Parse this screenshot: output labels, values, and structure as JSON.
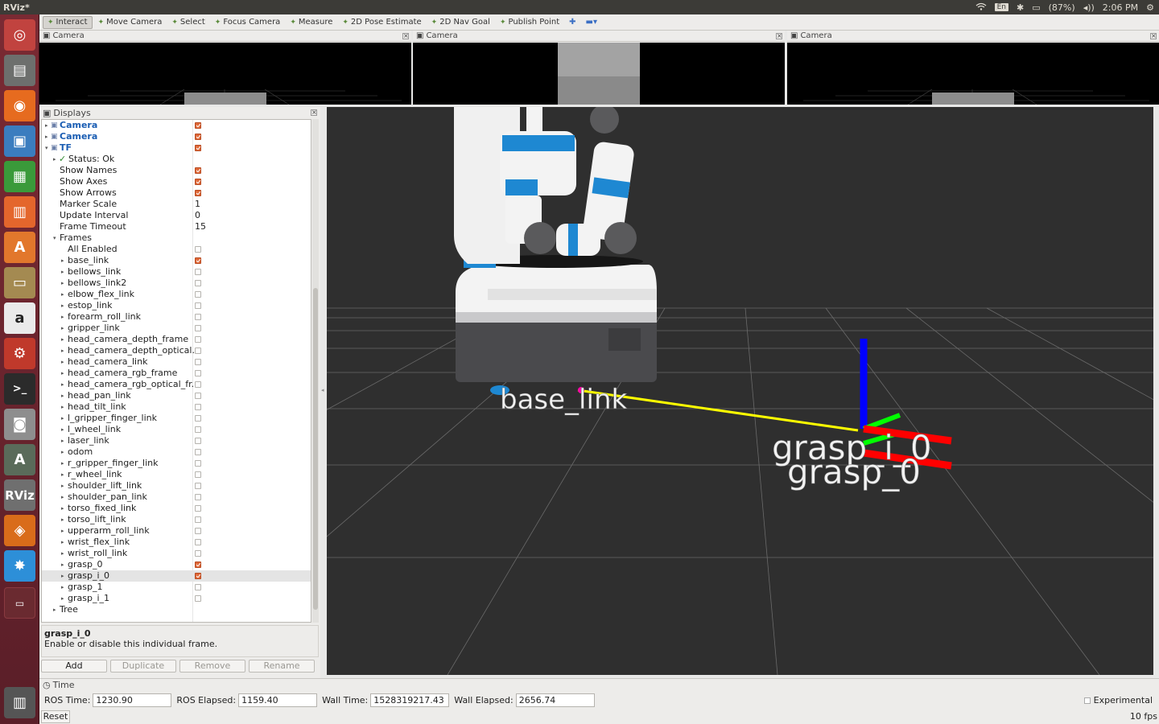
{
  "window": {
    "title": "RViz*"
  },
  "system_tray": {
    "keyboard": "En",
    "battery": "(87%)",
    "time": "2:06 PM"
  },
  "launcher": {
    "icons": [
      "ubuntu-icon",
      "files-icon",
      "firefox-icon",
      "image-viewer-icon",
      "spreadsheet-icon",
      "presentation-icon",
      "software-center-icon",
      "archive-manager-icon",
      "amazon-icon",
      "system-settings-icon",
      "terminal-icon",
      "screenshot-icon",
      "software-updater-icon",
      "rviz-icon",
      "app-icon",
      "gazebo-icon",
      "workspace-icon",
      "trash-icon"
    ],
    "rviz_label": "RViz"
  },
  "toolbar": {
    "tools": [
      {
        "label": "Interact",
        "icon": "interact-icon",
        "active": true
      },
      {
        "label": "Move Camera",
        "icon": "move-camera-icon",
        "active": false
      },
      {
        "label": "Select",
        "icon": "select-icon",
        "active": false
      },
      {
        "label": "Focus Camera",
        "icon": "focus-camera-icon",
        "active": false
      },
      {
        "label": "Measure",
        "icon": "measure-icon",
        "active": false
      },
      {
        "label": "2D Pose Estimate",
        "icon": "pose-estimate-icon",
        "active": false
      },
      {
        "label": "2D Nav Goal",
        "icon": "nav-goal-icon",
        "active": false
      },
      {
        "label": "Publish Point",
        "icon": "publish-point-icon",
        "active": false
      }
    ]
  },
  "camera_panels": [
    {
      "title": "Camera"
    },
    {
      "title": "Camera"
    },
    {
      "title": "Camera"
    }
  ],
  "displays": {
    "title": "Displays",
    "tree": [
      {
        "label": "Camera",
        "level": 0,
        "blue": true,
        "check": true,
        "arrow": "closed"
      },
      {
        "label": "Camera",
        "level": 0,
        "blue": true,
        "check": true,
        "arrow": "closed"
      },
      {
        "label": "TF",
        "level": 0,
        "blue": true,
        "check": true,
        "arrow": "open"
      },
      {
        "label": "Status: Ok",
        "level": 1,
        "status": true,
        "arrow": "closed"
      },
      {
        "label": "Show Names",
        "level": 1,
        "check": true
      },
      {
        "label": "Show Axes",
        "level": 1,
        "check": true
      },
      {
        "label": "Show Arrows",
        "level": 1,
        "check": true
      },
      {
        "label": "Marker Scale",
        "level": 1,
        "value": "1"
      },
      {
        "label": "Update Interval",
        "level": 1,
        "value": "0"
      },
      {
        "label": "Frame Timeout",
        "level": 1,
        "value": "15"
      },
      {
        "label": "Frames",
        "level": 1,
        "arrow": "open"
      },
      {
        "label": "All Enabled",
        "level": 2,
        "check": false
      },
      {
        "label": "base_link",
        "level": 2,
        "check": true,
        "arrow": "closed"
      },
      {
        "label": "bellows_link",
        "level": 2,
        "check": false,
        "arrow": "closed"
      },
      {
        "label": "bellows_link2",
        "level": 2,
        "check": false,
        "arrow": "closed"
      },
      {
        "label": "elbow_flex_link",
        "level": 2,
        "check": false,
        "arrow": "closed"
      },
      {
        "label": "estop_link",
        "level": 2,
        "check": false,
        "arrow": "closed"
      },
      {
        "label": "forearm_roll_link",
        "level": 2,
        "check": false,
        "arrow": "closed"
      },
      {
        "label": "gripper_link",
        "level": 2,
        "check": false,
        "arrow": "closed"
      },
      {
        "label": "head_camera_depth_frame",
        "level": 2,
        "check": false,
        "arrow": "closed"
      },
      {
        "label": "head_camera_depth_optical...",
        "level": 2,
        "check": false,
        "arrow": "closed"
      },
      {
        "label": "head_camera_link",
        "level": 2,
        "check": false,
        "arrow": "closed"
      },
      {
        "label": "head_camera_rgb_frame",
        "level": 2,
        "check": false,
        "arrow": "closed"
      },
      {
        "label": "head_camera_rgb_optical_fr...",
        "level": 2,
        "check": false,
        "arrow": "closed"
      },
      {
        "label": "head_pan_link",
        "level": 2,
        "check": false,
        "arrow": "closed"
      },
      {
        "label": "head_tilt_link",
        "level": 2,
        "check": false,
        "arrow": "closed"
      },
      {
        "label": "l_gripper_finger_link",
        "level": 2,
        "check": false,
        "arrow": "closed"
      },
      {
        "label": "l_wheel_link",
        "level": 2,
        "check": false,
        "arrow": "closed"
      },
      {
        "label": "laser_link",
        "level": 2,
        "check": false,
        "arrow": "closed"
      },
      {
        "label": "odom",
        "level": 2,
        "check": false,
        "arrow": "closed"
      },
      {
        "label": "r_gripper_finger_link",
        "level": 2,
        "check": false,
        "arrow": "closed"
      },
      {
        "label": "r_wheel_link",
        "level": 2,
        "check": false,
        "arrow": "closed"
      },
      {
        "label": "shoulder_lift_link",
        "level": 2,
        "check": false,
        "arrow": "closed"
      },
      {
        "label": "shoulder_pan_link",
        "level": 2,
        "check": false,
        "arrow": "closed"
      },
      {
        "label": "torso_fixed_link",
        "level": 2,
        "check": false,
        "arrow": "closed"
      },
      {
        "label": "torso_lift_link",
        "level": 2,
        "check": false,
        "arrow": "closed"
      },
      {
        "label": "upperarm_roll_link",
        "level": 2,
        "check": false,
        "arrow": "closed"
      },
      {
        "label": "wrist_flex_link",
        "level": 2,
        "check": false,
        "arrow": "closed"
      },
      {
        "label": "wrist_roll_link",
        "level": 2,
        "check": false,
        "arrow": "closed"
      },
      {
        "label": "grasp_0",
        "level": 2,
        "check": true,
        "arrow": "closed"
      },
      {
        "label": "grasp_i_0",
        "level": 2,
        "check": true,
        "arrow": "closed",
        "selected": true
      },
      {
        "label": "grasp_1",
        "level": 2,
        "check": false,
        "arrow": "closed"
      },
      {
        "label": "grasp_i_1",
        "level": 2,
        "check": false,
        "arrow": "closed"
      },
      {
        "label": "Tree",
        "level": 1,
        "arrow": "closed"
      }
    ],
    "description_title": "grasp_i_0",
    "description_text": "Enable or disable this individual frame.",
    "buttons": [
      {
        "label": "Add",
        "enabled": true
      },
      {
        "label": "Duplicate",
        "enabled": false
      },
      {
        "label": "Remove",
        "enabled": false
      },
      {
        "label": "Rename",
        "enabled": false
      }
    ]
  },
  "scene": {
    "labels": {
      "base": "base_link",
      "grasp_a": "grasp_i_0",
      "grasp_b": "grasp_0"
    },
    "colors": {
      "x_axis": "#ff0000",
      "y_axis": "#00ff00",
      "z_axis": "#0000ff",
      "arrow": "#ffff00",
      "robot_blue": "#1e88d2"
    }
  },
  "time": {
    "title": "Time",
    "ros_time_label": "ROS Time:",
    "ros_time": "1230.90",
    "ros_elapsed_label": "ROS Elapsed:",
    "ros_elapsed": "1159.40",
    "wall_time_label": "Wall Time:",
    "wall_time": "1528319217.43",
    "wall_elapsed_label": "Wall Elapsed:",
    "wall_elapsed": "2656.74",
    "experimental_label": "Experimental",
    "reset_label": "Reset",
    "fps": "10 fps"
  }
}
